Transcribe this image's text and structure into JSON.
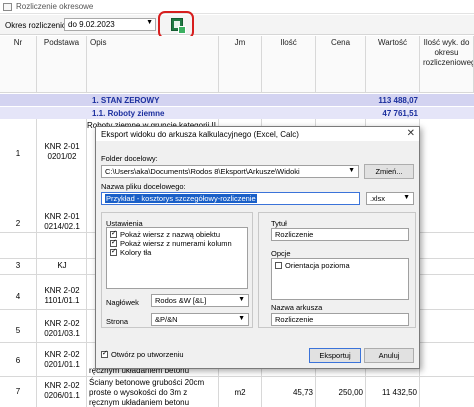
{
  "window": {
    "title": "Rozliczenie okresowe"
  },
  "toolbar": {
    "period_label": "Okres rozliczeniowy",
    "period_value": "do 9.02.2023",
    "export_icon": "excel-export-icon"
  },
  "table": {
    "headers": {
      "nr": "Nr",
      "podstawa": "Podstawa",
      "opis": "Opis",
      "jm": "Jm",
      "ilosc": "Ilość",
      "cena": "Cena",
      "wartosc": "Wartość",
      "ilosc_okres": "Ilość wyk. do okresu rozliczeniowego"
    },
    "stage": {
      "name": "1. STAN ZEROWY",
      "value": "113 488,07"
    },
    "group": {
      "name": "1.1. Roboty ziemne",
      "value": "47 761,51"
    },
    "row1": {
      "nr": "1",
      "podstawa": "KNR 2-01 0201/02",
      "opis": "Roboty ziemne w gruncie kategorii II"
    },
    "row2": {
      "nr": "2",
      "podstawa": "KNR 2-01 0214/02.1"
    },
    "row3": {
      "nr": "3",
      "podstawa": "KJ"
    },
    "row4": {
      "nr": "4",
      "podstawa": "KNR 2-02 1101/01.1"
    },
    "row5": {
      "nr": "5",
      "podstawa": "KNR 2-02 0201/03.1"
    },
    "row6": {
      "nr": "6",
      "podstawa": "KNR 2-02 0201/01.1",
      "opis": "ręcznym układaniem betonu"
    },
    "row7": {
      "nr": "7",
      "podstawa": "KNR 2-02 0206/01.1",
      "opis_1": "Ściany betonowe grubości 20cm",
      "opis_2": "proste o wysokości do 3m z",
      "opis_3": "ręcznym układaniem betonu",
      "jm": "m2",
      "ilosc": "45,73",
      "cena": "250,00",
      "wartosc": "11 432,50"
    }
  },
  "dialog": {
    "title": "Eksport widoku do arkusza kalkulacyjnego (Excel, Calc)",
    "folder_label": "Folder docelowy:",
    "folder_value": "C:\\Users\\aka\\Documents\\Rodos 8\\Eksport\\Arkusze\\Widoki",
    "change_button": "Zmień...",
    "filename_label": "Nazwa pliku docelowego:",
    "filename_value": "Przykład - kosztorys szczegółowy-rozliczenie",
    "extension_value": ".xlsx",
    "settings_label": "Ustawienia",
    "settings_items": [
      {
        "label": "Pokaż wiersz z nazwą obiektu",
        "checked": true
      },
      {
        "label": "Pokaż wiersz z numerami kolumn",
        "checked": true
      },
      {
        "label": "Kolory tła",
        "checked": true
      }
    ],
    "header_label": "Nagłówek",
    "header_value": "Rodos &W [&L]",
    "page_label": "Strona",
    "page_value": "&P/&N",
    "title_label": "Tytuł",
    "title_value": "Rozliczenie",
    "options_label": "Opcje",
    "options_items": [
      {
        "label": "Orientacja pozioma",
        "checked": false
      }
    ],
    "sheet_label": "Nazwa arkusza",
    "sheet_value": "Rozliczenie",
    "open_after_label": "Otwórz po utworzeniu",
    "open_after_checked": true,
    "export_button": "Eksportuj",
    "cancel_button": "Anuluj"
  }
}
